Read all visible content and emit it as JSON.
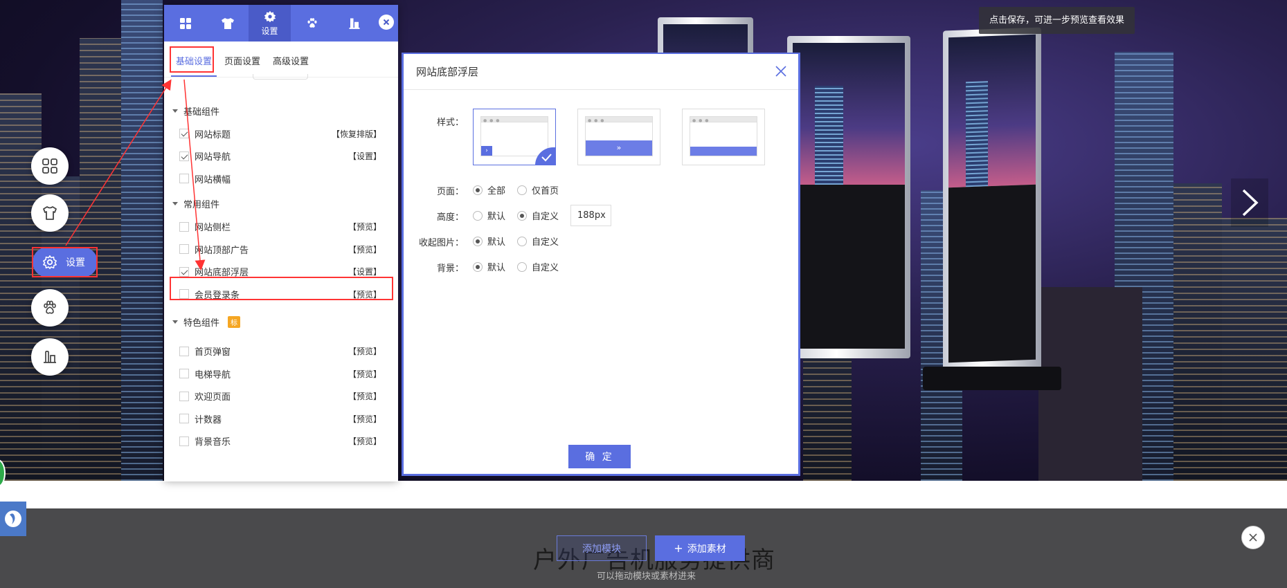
{
  "colors": {
    "accent": "#5a6ee0",
    "highlight": "#ff3333"
  },
  "banner": {
    "tip": "点击保存，可进一步预览查看效果"
  },
  "left_floating": {
    "pill_label": "设置",
    "icons": [
      "grid-icon",
      "shirt-icon",
      "gear-icon",
      "paw-icon",
      "bucket-icon"
    ]
  },
  "panel": {
    "tabs": [
      {
        "icon": "grid-icon",
        "label": ""
      },
      {
        "icon": "shirt-icon",
        "label": ""
      },
      {
        "icon": "gear-icon",
        "label": "设置",
        "active": true
      },
      {
        "icon": "paw-icon",
        "label": ""
      },
      {
        "icon": "bucket-icon",
        "label": ""
      }
    ],
    "subtabs": [
      "基础设置",
      "页面设置",
      "高级设置"
    ],
    "groups": {
      "basic": {
        "title": "基础组件",
        "items": [
          {
            "label": "网站标题",
            "checked": true,
            "action": "【恢复排版】"
          },
          {
            "label": "网站导航",
            "checked": true,
            "action": "【设置】"
          },
          {
            "label": "网站横幅",
            "checked": false,
            "action": ""
          }
        ]
      },
      "common": {
        "title": "常用组件",
        "items": [
          {
            "label": "网站侧栏",
            "checked": false,
            "action": "【预览】"
          },
          {
            "label": "网站顶部广告",
            "checked": false,
            "action": "【预览】"
          },
          {
            "label": "网站底部浮层",
            "checked": true,
            "action": "【设置】"
          },
          {
            "label": "会员登录条",
            "checked": false,
            "action": "【预览】"
          }
        ]
      },
      "special": {
        "title": "特色组件",
        "tag": "标",
        "items": [
          {
            "label": "首页弹窗",
            "checked": false,
            "action": "【预览】"
          },
          {
            "label": "电梯导航",
            "checked": false,
            "action": "【预览】"
          },
          {
            "label": "欢迎页面",
            "checked": false,
            "action": "【预览】"
          },
          {
            "label": "计数器",
            "checked": false,
            "action": "【预览】"
          },
          {
            "label": "背景音乐",
            "checked": false,
            "action": "【预览】"
          }
        ]
      }
    }
  },
  "modal": {
    "title": "网站底部浮层",
    "style_label": "样式：",
    "page_label": "页面：",
    "page_options": [
      "全部",
      "仅首页"
    ],
    "page_selected": 0,
    "height_label": "高度：",
    "height_options": [
      "默认",
      "自定义"
    ],
    "height_selected": 1,
    "height_value": "188px",
    "collapse_label": "收起图片：",
    "collapse_options": [
      "默认",
      "自定义"
    ],
    "collapse_selected": 0,
    "bg_label": "背景：",
    "bg_options": [
      "默认",
      "自定义"
    ],
    "bg_selected": 0,
    "ok": "确 定"
  },
  "bottom": {
    "title": "户外广告机服务提供商",
    "subtitle": "可以拖动模块或素材进来",
    "add_module": "添加模块",
    "add_material": "添加素材"
  }
}
